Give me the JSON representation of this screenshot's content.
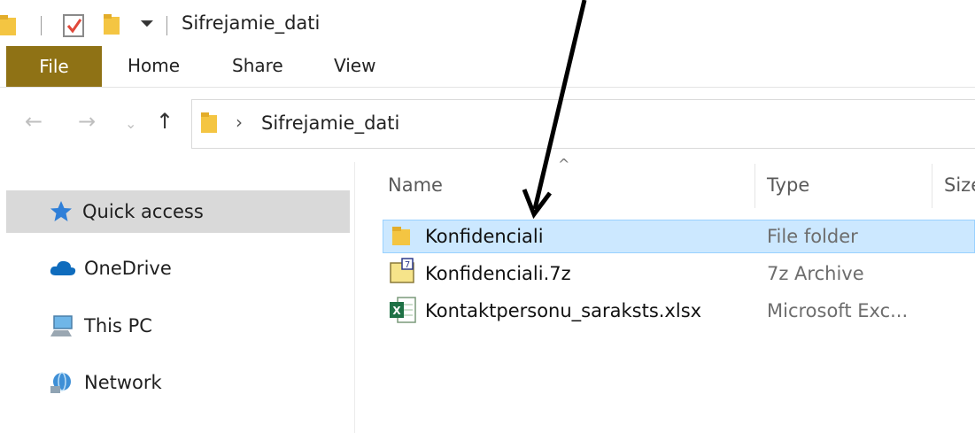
{
  "window": {
    "title": "Sifrejamie_dati"
  },
  "ribbon": {
    "tabs": [
      "File",
      "Home",
      "Share",
      "View"
    ]
  },
  "address": {
    "path": "Sifrejamie_dati"
  },
  "sidebar": {
    "items": [
      {
        "label": "Quick access",
        "icon": "star-icon",
        "selected": true
      },
      {
        "label": "OneDrive",
        "icon": "cloud-icon"
      },
      {
        "label": "This PC",
        "icon": "computer-icon"
      },
      {
        "label": "Network",
        "icon": "network-icon"
      }
    ]
  },
  "columns": {
    "name": "Name",
    "type": "Type",
    "size": "Size"
  },
  "files": [
    {
      "name": "Konfidenciali",
      "type": "File folder",
      "icon": "folder-icon",
      "selected": true
    },
    {
      "name": "Konfidenciali.7z",
      "type": "7z Archive",
      "icon": "7z-archive-icon"
    },
    {
      "name": "Kontaktpersonu_saraksts.xlsx",
      "type": "Microsoft Exc...",
      "icon": "excel-file-icon"
    }
  ],
  "colors": {
    "file_tab": "#8f7215",
    "selected_row": "#cce8ff",
    "selected_sidebar": "#d9d9d9",
    "folder": "#f4c542",
    "arrow": "#000000"
  }
}
